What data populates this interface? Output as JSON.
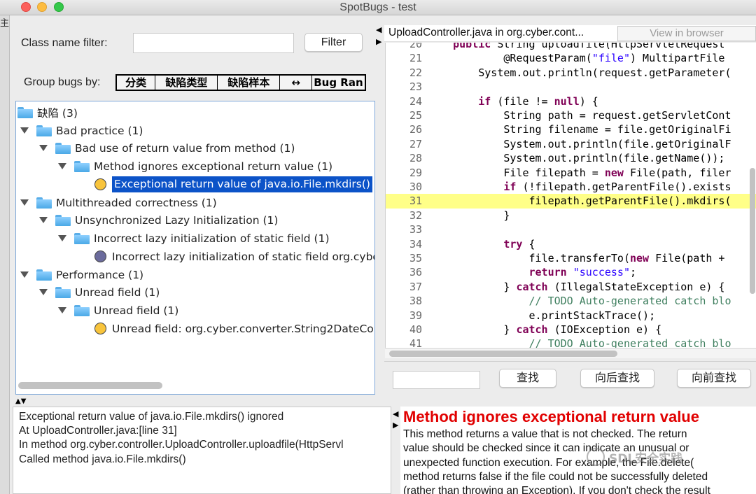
{
  "window": {
    "title": "SpotBugs - test",
    "bg_char": "主"
  },
  "filter": {
    "label": "Class name filter:",
    "value": "",
    "button": "Filter"
  },
  "group": {
    "label": "Group bugs by:",
    "options": [
      "分类",
      "缺陷类型",
      "缺陷样本",
      "↔",
      "Bug Ran"
    ]
  },
  "tree": {
    "rows": [
      {
        "text": "缺陷 (3)",
        "kind": "folder"
      },
      {
        "text": "Bad practice (1)",
        "kind": "folder"
      },
      {
        "text": "Bad use of return value from method (1)",
        "kind": "folder"
      },
      {
        "text": "Method ignores exceptional return value (1)",
        "kind": "folder"
      },
      {
        "text": "Exceptional return value of java.io.File.mkdirs()",
        "kind": "bug-yellow",
        "selected": true
      },
      {
        "text": "Multithreaded correctness (1)",
        "kind": "folder"
      },
      {
        "text": "Unsynchronized Lazy Initialization (1)",
        "kind": "folder"
      },
      {
        "text": "Incorrect lazy initialization of static field (1)",
        "kind": "folder"
      },
      {
        "text": "Incorrect lazy initialization of static field org.cybe",
        "kind": "bug-purple"
      },
      {
        "text": "Performance (1)",
        "kind": "folder"
      },
      {
        "text": "Unread field (1)",
        "kind": "folder"
      },
      {
        "text": "Unread field (1)",
        "kind": "folder"
      },
      {
        "text": "Unread field: org.cyber.converter.String2DateCo",
        "kind": "bug-yellow"
      }
    ]
  },
  "code": {
    "file_label": "UploadController.java in org.cyber.cont...",
    "view_browser": "View in browser",
    "highlight_line": 31,
    "lines": [
      {
        "n": "20",
        "t": "    public String uploadfile(HttpServletRequest"
      },
      {
        "n": "21",
        "t": "            @RequestParam(\"file\") MultipartFile"
      },
      {
        "n": "22",
        "t": "        System.out.println(request.getParameter("
      },
      {
        "n": "23",
        "t": ""
      },
      {
        "n": "24",
        "t": "        if (file != null) {"
      },
      {
        "n": "25",
        "t": "            String path = request.getServletCont"
      },
      {
        "n": "26",
        "t": "            String filename = file.getOriginalFi"
      },
      {
        "n": "27",
        "t": "            System.out.println(file.getOriginalF"
      },
      {
        "n": "28",
        "t": "            System.out.println(file.getName());"
      },
      {
        "n": "29",
        "t": "            File filepath = new File(path, filer"
      },
      {
        "n": "30",
        "t": "            if (!filepath.getParentFile().exists"
      },
      {
        "n": "31",
        "t": "                filepath.getParentFile().mkdirs("
      },
      {
        "n": "32",
        "t": "            }"
      },
      {
        "n": "33",
        "t": ""
      },
      {
        "n": "34",
        "t": "            try {"
      },
      {
        "n": "35",
        "t": "                file.transferTo(new File(path +"
      },
      {
        "n": "36",
        "t": "                return \"success\";"
      },
      {
        "n": "37",
        "t": "            } catch (IllegalStateException e) {"
      },
      {
        "n": "38",
        "t": "                // TODO Auto-generated catch blo"
      },
      {
        "n": "39",
        "t": "                e.printStackTrace();"
      },
      {
        "n": "40",
        "t": "            } catch (IOException e) {"
      },
      {
        "n": "41",
        "t": "                // TODO Auto-generated catch blo"
      }
    ],
    "find_value": "",
    "find_label": "查找",
    "find_next_label": "向后查找",
    "find_prev_label": "向前查找"
  },
  "details": {
    "lines": [
      "Exceptional return value of java.io.File.mkdirs() ignored",
      "At UploadController.java:[line 31]",
      "In method org.cyber.controller.UploadController.uploadfile(HttpServl",
      "Called method java.io.File.mkdirs()"
    ]
  },
  "description": {
    "title": "Method ignores exceptional return value",
    "lines": [
      "This method returns a value that is not checked. The return",
      "value should be checked since it can indicate an unusual or",
      "unexpected function execution. For example, the File.delete(",
      "method returns false if the file could not be successfully deleted",
      "(rather than throwing an Exception). If you don't check the result"
    ],
    "watermark": "SDL安全实践"
  },
  "colors": {
    "selection": "#0c53c8",
    "highlight": "#ffff88",
    "title_red": "#e10000"
  }
}
